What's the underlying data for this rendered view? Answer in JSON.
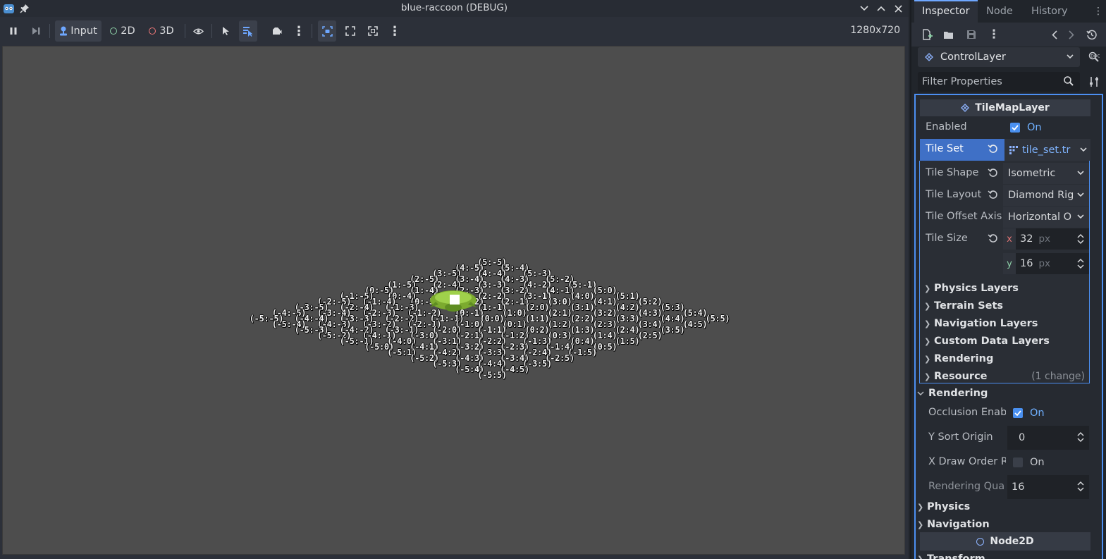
{
  "window": {
    "title": "blue-raccoon (DEBUG)",
    "resolution": "1280x720"
  },
  "toolbar": {
    "input_label": "Input",
    "mode_2d_label": "2D",
    "mode_3d_label": "3D"
  },
  "tile_coordinates": [
    {
      "q": 5,
      "r": -5,
      "label": "(5:-5)"
    },
    {
      "q": 4,
      "r": -5,
      "label": "(4:-5)"
    },
    {
      "q": 5,
      "r": -4,
      "label": "(5:-4)"
    },
    {
      "q": 3,
      "r": -5,
      "label": "(3:-5)"
    },
    {
      "q": 4,
      "r": -4,
      "label": "(4:-4)"
    },
    {
      "q": 5,
      "r": -3,
      "label": "(5:-3)"
    },
    {
      "q": 2,
      "r": -5,
      "label": "(2:-5)"
    },
    {
      "q": 3,
      "r": -4,
      "label": "(3:-4)"
    },
    {
      "q": 4,
      "r": -3,
      "label": "(4:-3)"
    },
    {
      "q": 5,
      "r": -2,
      "label": "(5:-2)"
    },
    {
      "q": 1,
      "r": -5,
      "label": "(1:-5)"
    },
    {
      "q": 2,
      "r": -4,
      "label": "(2:-4)"
    },
    {
      "q": 3,
      "r": -3,
      "label": "(3:-3)"
    },
    {
      "q": 4,
      "r": -2,
      "label": "(4:-2)"
    },
    {
      "q": 5,
      "r": -1,
      "label": "(5:-1)"
    },
    {
      "q": 0,
      "r": -5,
      "label": "(0:-5)"
    },
    {
      "q": 1,
      "r": -4,
      "label": "(1:-4)"
    },
    {
      "q": 2,
      "r": -3,
      "label": "(2:-3)"
    },
    {
      "q": 3,
      "r": -2,
      "label": "(3:-2)"
    },
    {
      "q": 4,
      "r": -1,
      "label": "(4:-1)"
    },
    {
      "q": 5,
      "r": 0,
      "label": "(5:0)"
    },
    {
      "q": -1,
      "r": -5,
      "label": "(-1:-5)"
    },
    {
      "q": 0,
      "r": -4,
      "label": "(0:-4)"
    },
    {
      "q": 1,
      "r": -3,
      "label": "(1:-3)"
    },
    {
      "q": 2,
      "r": -2,
      "label": "(2:-2)"
    },
    {
      "q": 3,
      "r": -1,
      "label": "(3:-1)"
    },
    {
      "q": 4,
      "r": 0,
      "label": "(4:0)"
    },
    {
      "q": 5,
      "r": 1,
      "label": "(5:1)"
    },
    {
      "q": -2,
      "r": -5,
      "label": "(-2:-5)"
    },
    {
      "q": -1,
      "r": -4,
      "label": "(-1:-4)"
    },
    {
      "q": 0,
      "r": -3,
      "label": "(0:-3)"
    },
    {
      "q": 1,
      "r": -2,
      "label": "(1:-2)"
    },
    {
      "q": 2,
      "r": -1,
      "label": "(2:-1)"
    },
    {
      "q": 3,
      "r": 0,
      "label": "(3:0)"
    },
    {
      "q": 4,
      "r": 1,
      "label": "(4:1)"
    },
    {
      "q": 5,
      "r": 2,
      "label": "(5:2)"
    },
    {
      "q": -3,
      "r": -5,
      "label": "(-3:-5)"
    },
    {
      "q": -2,
      "r": -4,
      "label": "(-2:-4)"
    },
    {
      "q": -1,
      "r": -3,
      "label": "(-1:-3)"
    },
    {
      "q": 1,
      "r": -1,
      "label": "(1:-1)"
    },
    {
      "q": 2,
      "r": 0,
      "label": "(2:0)"
    },
    {
      "q": 3,
      "r": 1,
      "label": "(3:1)"
    },
    {
      "q": 4,
      "r": 2,
      "label": "(4:2)"
    },
    {
      "q": 5,
      "r": 3,
      "label": "(5:3)"
    },
    {
      "q": -4,
      "r": -5,
      "label": "(-4:-5)"
    },
    {
      "q": -3,
      "r": -4,
      "label": "(-3:-4)"
    },
    {
      "q": -2,
      "r": -3,
      "label": "(-2:-3)"
    },
    {
      "q": -1,
      "r": -2,
      "label": "(-1:-2)"
    },
    {
      "q": 0,
      "r": -1,
      "label": "(0:-1)"
    },
    {
      "q": 1,
      "r": 0,
      "label": "(1:0)"
    },
    {
      "q": 2,
      "r": 1,
      "label": "(2:1)"
    },
    {
      "q": 3,
      "r": 2,
      "label": "(3:2)"
    },
    {
      "q": 4,
      "r": 3,
      "label": "(4:3)"
    },
    {
      "q": 5,
      "r": 4,
      "label": "(5:4)"
    },
    {
      "q": -5,
      "r": -5,
      "label": "(-5:-5)"
    },
    {
      "q": -4,
      "r": -4,
      "label": "(-4:-4)"
    },
    {
      "q": -3,
      "r": -3,
      "label": "(-3:-3)"
    },
    {
      "q": -2,
      "r": -2,
      "label": "(-2:-2)"
    },
    {
      "q": -1,
      "r": -1,
      "label": "(-1:-1)"
    },
    {
      "q": 0,
      "r": 0,
      "label": "(0:0)"
    },
    {
      "q": 1,
      "r": 1,
      "label": "(1:1)"
    },
    {
      "q": 2,
      "r": 2,
      "label": "(2:2)"
    },
    {
      "q": 3,
      "r": 3,
      "label": "(3:3)"
    },
    {
      "q": 4,
      "r": 4,
      "label": "(4:4)"
    },
    {
      "q": 5,
      "r": 5,
      "label": "(5:5)"
    },
    {
      "q": -5,
      "r": -4,
      "label": "(-5:-4)"
    },
    {
      "q": -4,
      "r": -3,
      "label": "(-4:-3)"
    },
    {
      "q": -3,
      "r": -2,
      "label": "(-3:-2)"
    },
    {
      "q": -2,
      "r": -1,
      "label": "(-2:-1)"
    },
    {
      "q": -1,
      "r": 0,
      "label": "(-1:0)"
    },
    {
      "q": 0,
      "r": 1,
      "label": "(0:1)"
    },
    {
      "q": 1,
      "r": 2,
      "label": "(1:2)"
    },
    {
      "q": 2,
      "r": 3,
      "label": "(2:3)"
    },
    {
      "q": 3,
      "r": 4,
      "label": "(3:4)"
    },
    {
      "q": 4,
      "r": 5,
      "label": "(4:5)"
    },
    {
      "q": -5,
      "r": -3,
      "label": "(-5:-3)"
    },
    {
      "q": -4,
      "r": -2,
      "label": "(-4:-2)"
    },
    {
      "q": -3,
      "r": -1,
      "label": "(-3:-1)"
    },
    {
      "q": -2,
      "r": 0,
      "label": "(-2:0)"
    },
    {
      "q": -1,
      "r": 1,
      "label": "(-1:1)"
    },
    {
      "q": 0,
      "r": 2,
      "label": "(0:2)"
    },
    {
      "q": 1,
      "r": 3,
      "label": "(1:3)"
    },
    {
      "q": 2,
      "r": 4,
      "label": "(2:4)"
    },
    {
      "q": 3,
      "r": 5,
      "label": "(3:5)"
    },
    {
      "q": -5,
      "r": -2,
      "label": "(-5:-2)"
    },
    {
      "q": -4,
      "r": -1,
      "label": "(-4:-1)"
    },
    {
      "q": -3,
      "r": 0,
      "label": "(-3:0)"
    },
    {
      "q": -2,
      "r": 1,
      "label": "(-2:1)"
    },
    {
      "q": -1,
      "r": 2,
      "label": "(-1:2)"
    },
    {
      "q": 0,
      "r": 3,
      "label": "(0:3)"
    },
    {
      "q": 1,
      "r": 4,
      "label": "(1:4)"
    },
    {
      "q": 2,
      "r": 5,
      "label": "(2:5)"
    },
    {
      "q": -5,
      "r": -1,
      "label": "(-5:-1)"
    },
    {
      "q": -4,
      "r": 0,
      "label": "(-4:0)"
    },
    {
      "q": -3,
      "r": 1,
      "label": "(-3:1)"
    },
    {
      "q": -2,
      "r": 2,
      "label": "(-2:2)"
    },
    {
      "q": -1,
      "r": 3,
      "label": "(-1:3)"
    },
    {
      "q": 0,
      "r": 4,
      "label": "(0:4)"
    },
    {
      "q": 1,
      "r": 5,
      "label": "(1:5)"
    },
    {
      "q": -5,
      "r": 0,
      "label": "(-5:0)"
    },
    {
      "q": -4,
      "r": 1,
      "label": "(-4:1)"
    },
    {
      "q": -3,
      "r": 2,
      "label": "(-3:2)"
    },
    {
      "q": -2,
      "r": 3,
      "label": "(-2:3)"
    },
    {
      "q": -1,
      "r": 4,
      "label": "(-1:4)"
    },
    {
      "q": 0,
      "r": 5,
      "label": "(0:5)"
    },
    {
      "q": -5,
      "r": 1,
      "label": "(-5:1)"
    },
    {
      "q": -4,
      "r": 2,
      "label": "(-4:2)"
    },
    {
      "q": -3,
      "r": 3,
      "label": "(-3:3)"
    },
    {
      "q": -2,
      "r": 4,
      "label": "(-2:4)"
    },
    {
      "q": -1,
      "r": 5,
      "label": "(-1:5)"
    },
    {
      "q": -5,
      "r": 2,
      "label": "(-5:2)"
    },
    {
      "q": -4,
      "r": 3,
      "label": "(-4:3)"
    },
    {
      "q": -3,
      "r": 4,
      "label": "(-3:4)"
    },
    {
      "q": -2,
      "r": 5,
      "label": "(-2:5)"
    },
    {
      "q": -5,
      "r": 3,
      "label": "(-5:3)"
    },
    {
      "q": -4,
      "r": 4,
      "label": "(-4:4)"
    },
    {
      "q": -3,
      "r": 5,
      "label": "(-3:5)"
    },
    {
      "q": -5,
      "r": 4,
      "label": "(-5:4)"
    },
    {
      "q": -4,
      "r": 5,
      "label": "(-4:5)"
    },
    {
      "q": -5,
      "r": 5,
      "label": "(-5:5)"
    }
  ],
  "inspector": {
    "tabs": [
      "Inspector",
      "Node",
      "History"
    ],
    "node_name": "ControlLayer",
    "filter_placeholder": "Filter Properties",
    "section_tilemaplayer": "TileMapLayer",
    "enabled_label": "Enabled",
    "enabled_value": "On",
    "tile_set_label": "Tile Set",
    "tile_set_value": "tile_set.tr",
    "tile_shape_label": "Tile Shape",
    "tile_shape_value": "Isometric",
    "tile_layout_label": "Tile Layout",
    "tile_layout_value": "Diamond Rig",
    "tile_offset_axis_label": "Tile Offset Axis",
    "tile_offset_axis_value": "Horizontal O",
    "tile_size_label": "Tile Size",
    "tile_size_x_axis": "x",
    "tile_size_x": "32",
    "tile_size_y_axis": "y",
    "tile_size_y": "16",
    "unit_px": "px",
    "groups": [
      "Physics Layers",
      "Terrain Sets",
      "Navigation Layers",
      "Custom Data Layers",
      "Rendering",
      "Resource"
    ],
    "resource_changes": "(1 change)",
    "rendering_section": "Rendering",
    "occlusion_label": "Occlusion Enab",
    "occlusion_value": "On",
    "y_sort_label": "Y Sort Origin",
    "y_sort_value": "0",
    "x_draw_label": "X Draw Order R",
    "x_draw_value": "On",
    "rendering_quadrant_label": "Rendering Qua",
    "rendering_quadrant_value": "16",
    "physics_section": "Physics",
    "navigation_section": "Navigation",
    "node2d_section": "Node2D",
    "transform_section": "Transform",
    "accent_color": "#4c8ff2"
  }
}
